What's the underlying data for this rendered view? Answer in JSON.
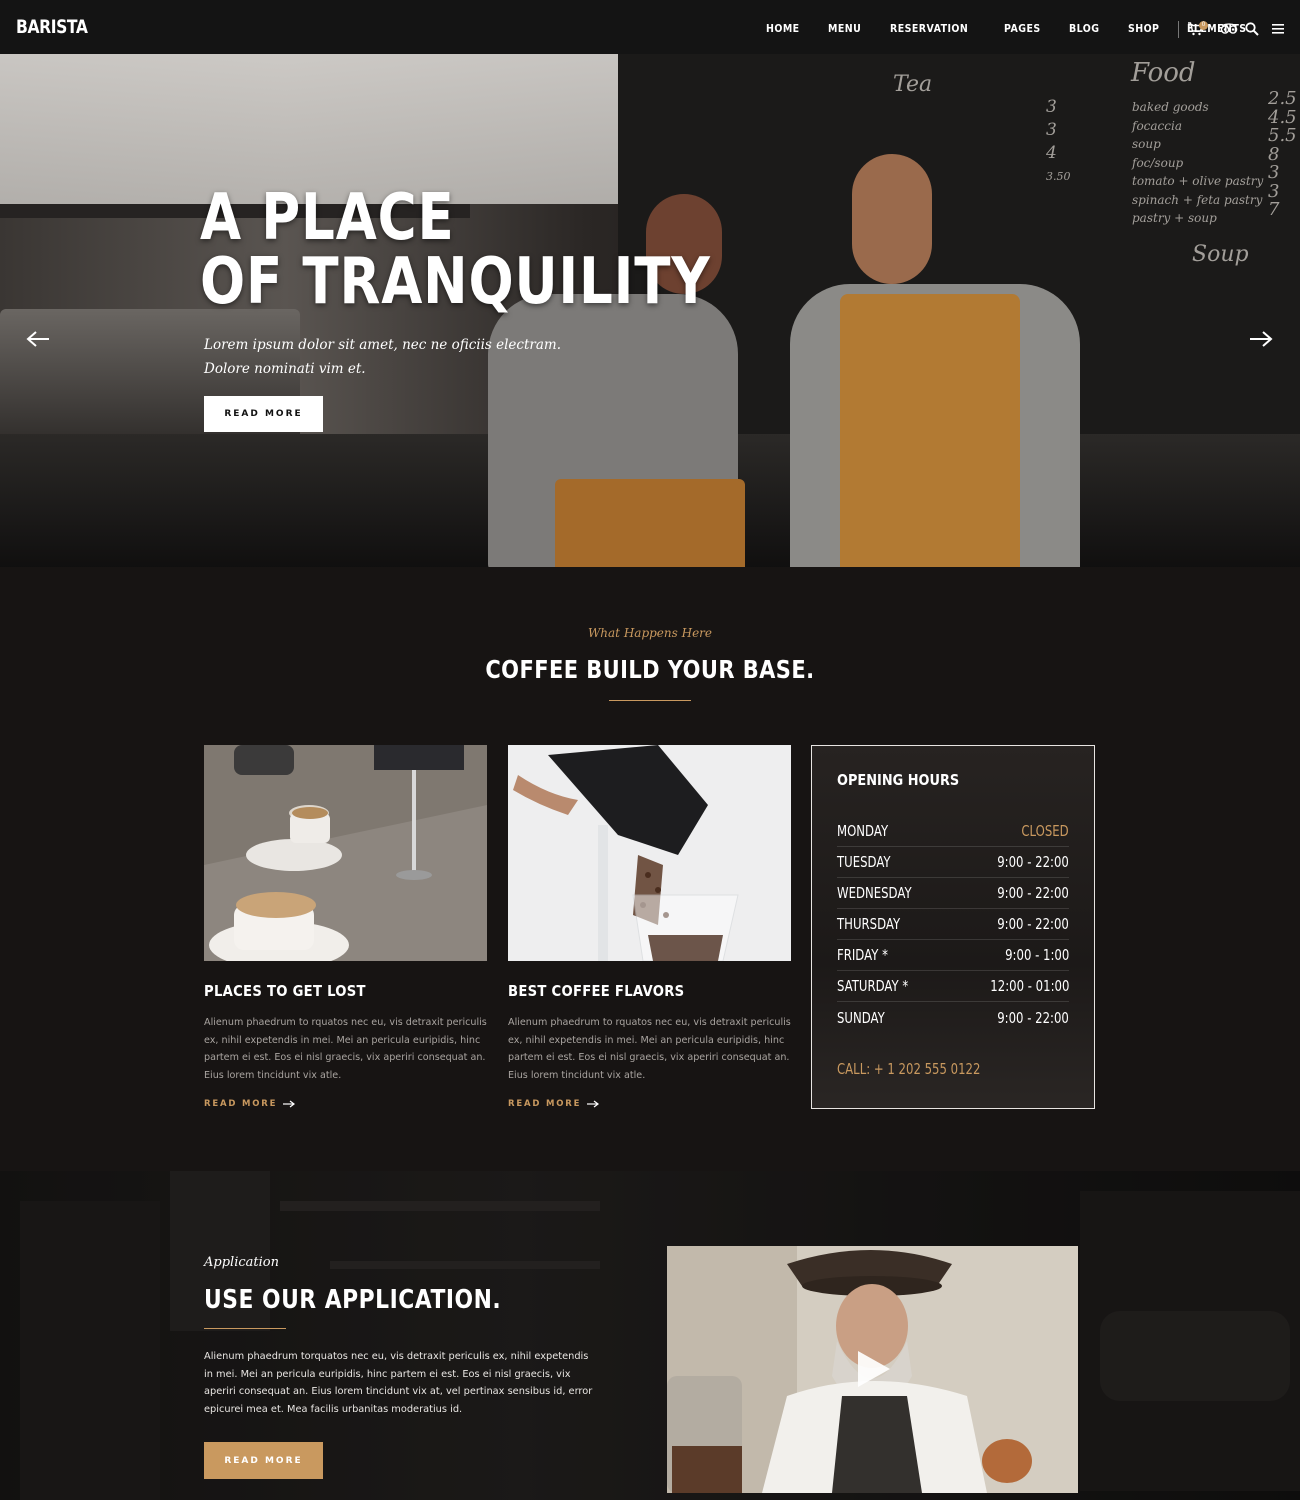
{
  "header": {
    "logo": "BARISTA",
    "nav": [
      "HOME",
      "MENU",
      "RESERVATION",
      "PAGES",
      "BLOG",
      "SHOP",
      "ELEMENTS"
    ],
    "cart_count": "0",
    "icons": [
      "cart-icon",
      "tripadvisor-icon",
      "search-icon",
      "menu-icon"
    ]
  },
  "hero": {
    "title_line1": "A PLACE",
    "title_line2": "OF TRANQUILITY",
    "subtitle_line1": "Lorem ipsum dolor sit amet, nec ne oficiis electram.",
    "subtitle_line2": "Dolore nominati vim et.",
    "button": "READ MORE",
    "chalkboard": {
      "food_heading": "Food",
      "food_items": [
        "baked goods",
        "focaccia",
        "soup",
        "foc/soup",
        "tomato + olive pastry",
        "spinach + feta pastry",
        "pastry + soup"
      ],
      "food_prices": [
        "2.5",
        "4.5",
        "5.5",
        "8",
        "3",
        "3",
        "7"
      ],
      "tea_heading": "Tea",
      "tea_prices": [
        "3",
        "3",
        "4",
        "3.50"
      ],
      "soup_label": "Soup"
    }
  },
  "section2": {
    "kicker": "What Happens Here",
    "title": "COFFEE BUILD YOUR BASE.",
    "cards": [
      {
        "title": "PLACES TO GET LOST",
        "text": "Alienum phaedrum to rquatos nec eu, vis detraxit periculis ex, nihil expetendis in mei. Mei an pericula euripidis, hinc partem ei est. Eos ei nisl graecis, vix aperiri consequat an. Eius lorem tincidunt vix atle.",
        "link": "READ MORE"
      },
      {
        "title": "BEST COFFEE FLAVORS",
        "text": "Alienum phaedrum to rquatos nec eu, vis detraxit periculis ex, nihil expetendis in mei. Mei an pericula euripidis, hinc partem ei est. Eos ei nisl graecis, vix aperiri consequat an. Eius lorem tincidunt vix atle.",
        "link": "READ MORE"
      }
    ],
    "hours": {
      "title": "OPENING HOURS",
      "rows": [
        {
          "day": "MONDAY",
          "time": "CLOSED"
        },
        {
          "day": "TUESDAY",
          "time": "9:00 - 22:00"
        },
        {
          "day": "WEDNESDAY",
          "time": "9:00 - 22:00"
        },
        {
          "day": "THURSDAY",
          "time": "9:00 - 22:00"
        },
        {
          "day": "FRIDAY *",
          "time": "9:00 - 1:00"
        },
        {
          "day": "SATURDAY *",
          "time": "12:00 - 01:00"
        },
        {
          "day": "SUNDAY",
          "time": "9:00 - 22:00"
        }
      ],
      "call": "CALL: + 1 202 555 0122"
    }
  },
  "section3": {
    "kicker": "Application",
    "title": "USE OUR APPLICATION.",
    "text": "Alienum phaedrum torquatos nec eu, vis detraxit periculis ex, nihil expetendis in mei. Mei an pericula euripidis, hinc partem ei est. Eos ei nisl graecis, vix aperiri consequat an. Eius lorem tincidunt vix at, vel pertinax sensibus id, error epicurei mea et. Mea facilis urbanitas moderatius id.",
    "button": "READ MORE"
  },
  "colors": {
    "accent": "#c9995f",
    "background": "#171413",
    "header": "#141414"
  }
}
